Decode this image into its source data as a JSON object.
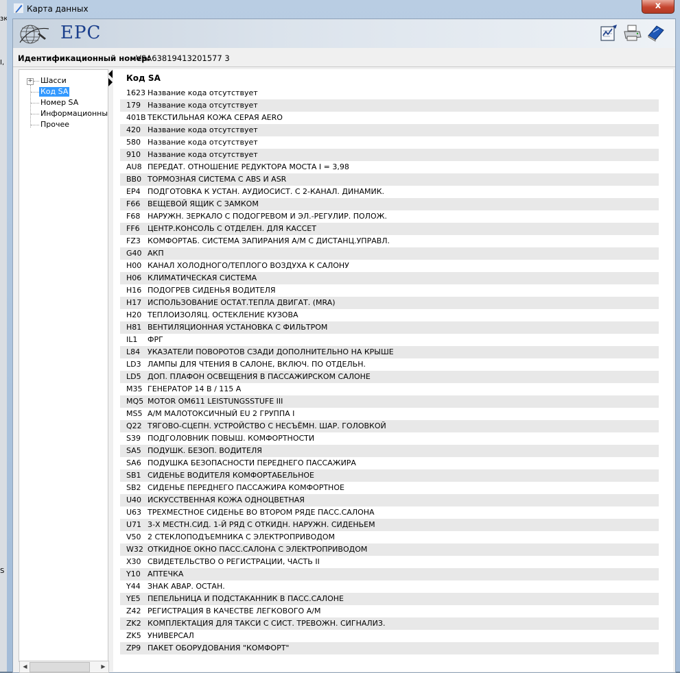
{
  "window": {
    "title": "Карта данных",
    "close_label": "x"
  },
  "header": {
    "logo_text": "EPC"
  },
  "ident": {
    "label": "Идентификационный номер:",
    "value": "VSA63819413201577 3"
  },
  "tree": {
    "items": [
      {
        "label": "Шасси",
        "selected": false,
        "expandable": true
      },
      {
        "label": "Код SA",
        "selected": true,
        "expandable": false
      },
      {
        "label": "Номер SA",
        "selected": false,
        "expandable": false
      },
      {
        "label": "Информационный тек",
        "selected": false,
        "expandable": false
      },
      {
        "label": "Прочее",
        "selected": false,
        "expandable": false
      }
    ]
  },
  "list": {
    "title": "Код SA",
    "rows": [
      {
        "code": "1623",
        "desc": "Название кода отсутствует"
      },
      {
        "code": "179",
        "desc": "Название кода отсутствует"
      },
      {
        "code": "401B",
        "desc": "ТЕКСТИЛЬНАЯ КОЖА СЕРАЯ AERO"
      },
      {
        "code": "420",
        "desc": "Название кода отсутствует"
      },
      {
        "code": "580",
        "desc": "Название кода отсутствует"
      },
      {
        "code": "910",
        "desc": "Название кода отсутствует"
      },
      {
        "code": "AU8",
        "desc": "ПЕРЕДАТ. ОТНОШЕНИЕ РЕДУКТОРА МОСТА I = 3,98"
      },
      {
        "code": "BB0",
        "desc": "ТОРМОЗНАЯ СИСТЕМА С ABS И ASR"
      },
      {
        "code": "EP4",
        "desc": "ПОДГОТОВКА К УСТАН. АУДИОСИСТ. С 2-КАНАЛ. ДИНАМИК."
      },
      {
        "code": "F66",
        "desc": "ВЕЩЕВОЙ ЯЩИК С ЗАМКОМ"
      },
      {
        "code": "F68",
        "desc": "НАРУЖН. ЗЕРКАЛО С ПОДОГРЕВОМ И ЭЛ.-РЕГУЛИР. ПОЛОЖ."
      },
      {
        "code": "FF6",
        "desc": "ЦЕНТР.КОНСОЛЬ С ОТДЕЛЕН. ДЛЯ КАССЕТ"
      },
      {
        "code": "FZ3",
        "desc": "КОМФОРТАБ. СИСТЕМА ЗАПИРАНИЯ А/М С ДИСТАНЦ.УПРАВЛ."
      },
      {
        "code": "G40",
        "desc": "АКП"
      },
      {
        "code": "H00",
        "desc": "КАНАЛ ХОЛОДНОГО/ТЕПЛОГО ВОЗДУХА К САЛОНУ"
      },
      {
        "code": "H06",
        "desc": "КЛИМАТИЧЕСКАЯ СИСТЕМА"
      },
      {
        "code": "H16",
        "desc": "ПОДОГРЕВ СИДЕНЬЯ ВОДИТЕЛЯ"
      },
      {
        "code": "H17",
        "desc": "ИСПОЛЬЗОВАНИЕ ОСТАТ.ТЕПЛА ДВИГАТ. (MRA)"
      },
      {
        "code": "H20",
        "desc": "ТЕПЛОИЗОЛЯЦ. ОСТЕКЛЕНИЕ КУЗОВА"
      },
      {
        "code": "H81",
        "desc": "ВЕНТИЛЯЦИОННАЯ УСТАНОВКА С ФИЛЬТРОМ"
      },
      {
        "code": "IL1",
        "desc": "ФРГ"
      },
      {
        "code": "L84",
        "desc": "УКАЗАТЕЛИ ПОВОРОТОВ СЗАДИ ДОПОЛНИТЕЛЬНО НА КРЫШЕ"
      },
      {
        "code": "LD3",
        "desc": "ЛАМПЫ ДЛЯ ЧТЕНИЯ В САЛОНЕ, ВКЛЮЧ. ПО ОТДЕЛЬН."
      },
      {
        "code": "LD5",
        "desc": "ДОП. ПЛАФОН ОСВЕЩЕНИЯ В ПАССАЖИРСКОМ САЛОНЕ"
      },
      {
        "code": "M35",
        "desc": "ГЕНЕРАТОР 14 В / 115 А"
      },
      {
        "code": "MQ5",
        "desc": "MOTOR OM611 LEISTUNGSSTUFE III"
      },
      {
        "code": "MS5",
        "desc": "А/М МАЛОТОКСИЧНЫЙ EU 2 ГРУППА I"
      },
      {
        "code": "Q22",
        "desc": "ТЯГОВО-СЦЕПН. УСТРОЙСТВО С НЕСЪЁМН. ШАР. ГОЛОВКОЙ"
      },
      {
        "code": "S39",
        "desc": "ПОДГОЛОВНИК ПОВЫШ. КОМФОРТНОСТИ"
      },
      {
        "code": "SA5",
        "desc": "ПОДУШК. БЕЗОП. ВОДИТЕЛЯ"
      },
      {
        "code": "SA6",
        "desc": "ПОДУШКА БЕЗОПАСНОСТИ ПЕРЕДНЕГО ПАССАЖИРА"
      },
      {
        "code": "SB1",
        "desc": "СИДЕНЬЕ ВОДИТЕЛЯ КОМФОРТАБЕЛЬНОЕ"
      },
      {
        "code": "SB2",
        "desc": "СИДЕНЬЕ ПЕРЕДНЕГО ПАССАЖИРА КОМФОРТНОЕ"
      },
      {
        "code": "U40",
        "desc": "ИСКУССТВЕННАЯ КОЖА ОДНОЦВЕТНАЯ"
      },
      {
        "code": "U63",
        "desc": "ТРЕХМЕСТНОЕ СИДЕНЬЕ ВО ВТОРОМ РЯДЕ ПАСС.САЛОНА"
      },
      {
        "code": "U71",
        "desc": "3-Х МЕСТН.СИД. 1-Й РЯД С ОТКИДН. НАРУЖН. СИДЕНЬЕМ"
      },
      {
        "code": "V50",
        "desc": "2 СТЕКЛОПОДЪЕМНИКА С ЭЛЕКТРОПРИВОДОМ"
      },
      {
        "code": "W32",
        "desc": "ОТКИДНОЕ ОКНО ПАСС.САЛОНА С ЭЛЕКТРОПРИВОДОМ"
      },
      {
        "code": "X30",
        "desc": "СВИДЕТЕЛЬСТВО О РЕГИСТРАЦИИ, ЧАСТЬ II"
      },
      {
        "code": "Y10",
        "desc": "АПТЕЧКА"
      },
      {
        "code": "Y44",
        "desc": "ЗНАК АВАР. ОСТАН."
      },
      {
        "code": "YE5",
        "desc": "ПЕПЕЛЬНИЦА И ПОДСТАКАННИК В ПАСС.САЛОНЕ"
      },
      {
        "code": "Z42",
        "desc": "РЕГИСТРАЦИЯ В КАЧЕСТВЕ ЛЕГКОВОГО А/М"
      },
      {
        "code": "ZK2",
        "desc": "КОМПЛЕКТАЦИЯ ДЛЯ ТАКСИ С СИСТ. ТРЕВОЖН. СИГНАЛИЗ."
      },
      {
        "code": "ZK5",
        "desc": "УНИВЕРСАЛ"
      },
      {
        "code": "ZP9",
        "desc": "ПАКЕТ ОБОРУДОВАНИЯ \"КОМФОРТ\""
      }
    ]
  },
  "background_fragments": [
    "зк",
    "I,",
    "S"
  ]
}
